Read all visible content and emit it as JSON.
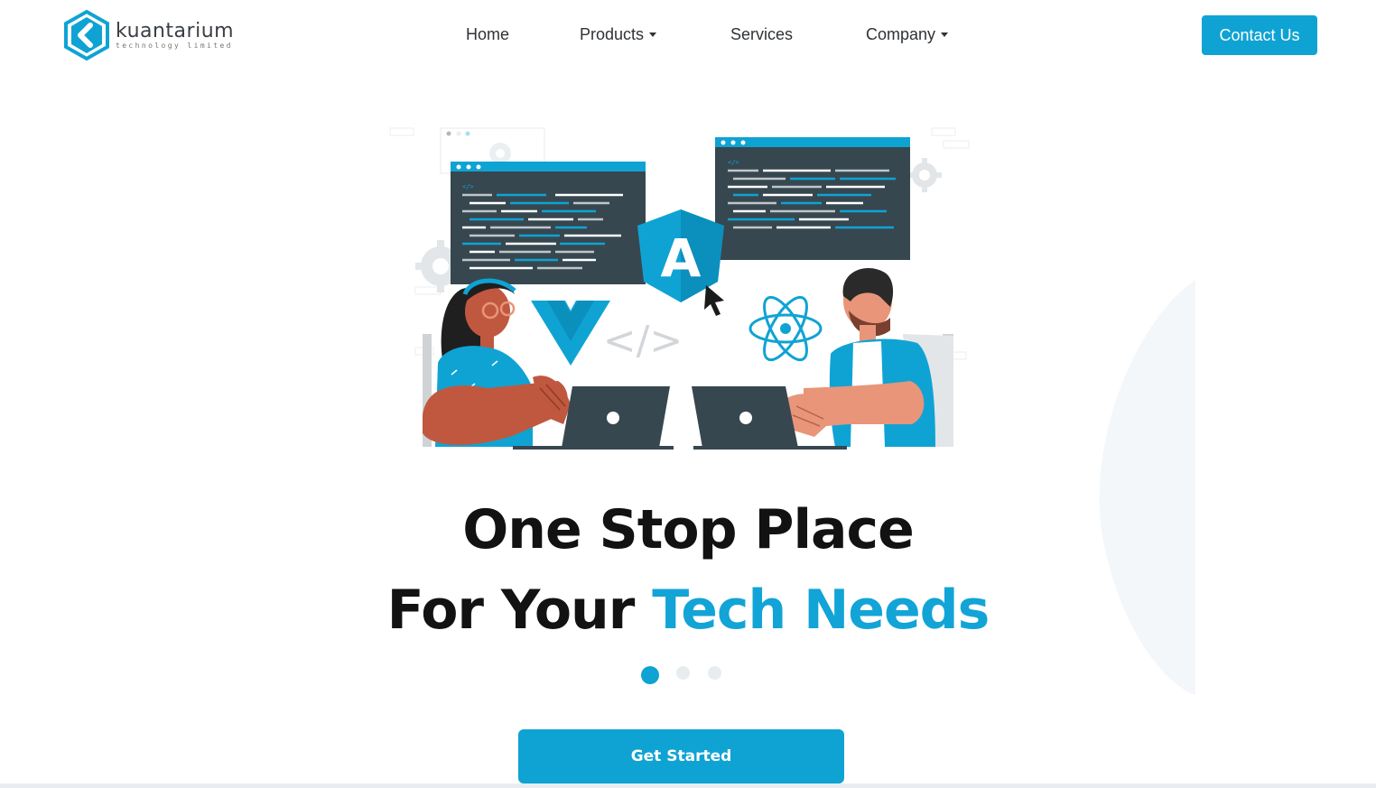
{
  "brand": {
    "name": "kuantarium",
    "tagline": "technology limited",
    "color": "#0fa3d4"
  },
  "nav": {
    "items": [
      {
        "label": "Home",
        "has_dropdown": false
      },
      {
        "label": "Products",
        "has_dropdown": true
      },
      {
        "label": "Services",
        "has_dropdown": false
      },
      {
        "label": "Company",
        "has_dropdown": true
      }
    ],
    "contact_label": "Contact Us"
  },
  "hero": {
    "illustration_icons": [
      "vue-icon",
      "angular-icon",
      "react-icon",
      "code-brackets-icon",
      "gear-icon",
      "laptop-icon",
      "cursor-icon"
    ],
    "headline_line1": "One Stop Place",
    "headline_line2_prefix": "For Your ",
    "headline_line2_accent": "Tech Needs",
    "carousel": {
      "slide_count": 3,
      "active_slide": 1
    },
    "cta_label": "Get Started"
  },
  "colors": {
    "accent": "#0fa3d4",
    "dark_text": "#121212",
    "screen_dark": "#37474f",
    "skin_dark": "#c0583f",
    "skin_light": "#e8957a"
  }
}
